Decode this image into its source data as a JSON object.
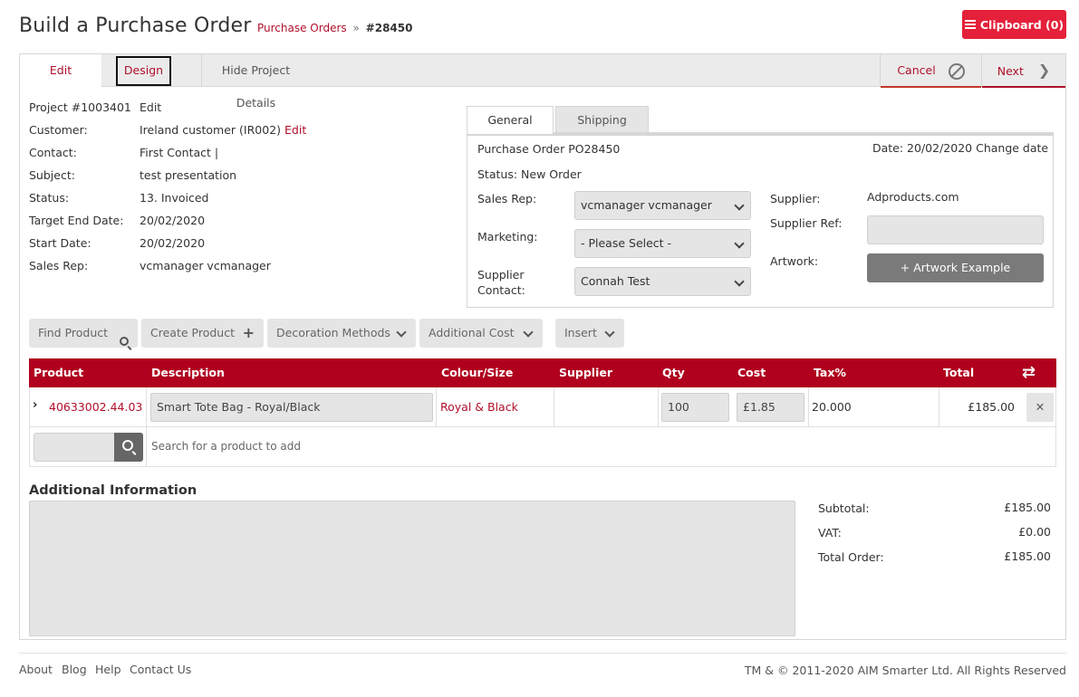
{
  "header": {
    "title": "Build a Purchase Order",
    "breadcrumb_link": "Purchase Orders",
    "breadcrumb_sep": "»",
    "breadcrumb_current": "#28450",
    "clipboard_label": "Clipboard (0)"
  },
  "tabs": {
    "edit": "Edit",
    "design": "Design",
    "hide": "Hide Project Details",
    "cancel": "Cancel",
    "next": "Next"
  },
  "project": {
    "project_label": "Project #1003401",
    "project_edit": "Edit",
    "fields": [
      {
        "label": "Customer:",
        "value": "Ireland customer (IR002)",
        "link": "Edit"
      },
      {
        "label": "Contact:",
        "value": "First Contact |"
      },
      {
        "label": "Subject:",
        "value": "test presentation"
      },
      {
        "label": "Status:",
        "value": "13. Invoiced"
      },
      {
        "label": "Target End Date:",
        "value": "20/02/2020"
      },
      {
        "label": "Start Date:",
        "value": "20/02/2020"
      },
      {
        "label": "Sales Rep:",
        "value": "vcmanager vcmanager"
      }
    ]
  },
  "po": {
    "tab_general": "General",
    "tab_shipping": "Shipping",
    "title": "Purchase Order PO28450",
    "date_label": "Date: 20/02/2020",
    "change_date": "Change date",
    "status_label": "Status:",
    "status_value": "New Order",
    "sales_rep_label": "Sales Rep:",
    "sales_rep_value": "vcmanager vcmanager",
    "marketing_label": "Marketing:",
    "marketing_value": "- Please Select -",
    "supplier_contact_label_1": "Supplier",
    "supplier_contact_label_2": "Contact:",
    "supplier_contact_value": "Connah Test",
    "supplier_label": "Supplier:",
    "supplier_value": "Adproducts.com",
    "supplier_ref_label": "Supplier Ref:",
    "supplier_ref_value": "",
    "artwork_label": "Artwork:",
    "artwork_button": "+ Artwork Example"
  },
  "toolbar": {
    "find_product": "Find Product",
    "create_product": "Create Product",
    "decoration_methods": "Decoration Methods",
    "additional_cost": "Additional Cost",
    "insert": "Insert"
  },
  "table": {
    "headers": [
      "Product",
      "Description",
      "Colour/Size",
      "Supplier",
      "Qty",
      "Cost",
      "Tax%",
      "Total"
    ],
    "rows": [
      {
        "product": "40633002.44.03",
        "description": "Smart Tote Bag - Royal/Black",
        "colour_size": "Royal & Black",
        "supplier": "",
        "qty": "100",
        "cost": "£1.85",
        "tax": "20.000",
        "total": "£185.00"
      }
    ],
    "search_placeholder": "Search for a product to add"
  },
  "additional_info": {
    "title": "Additional Information",
    "text": ""
  },
  "totals": {
    "subtotal_label": "Subtotal:",
    "subtotal_value": "£185.00",
    "vat_label": "VAT:",
    "vat_value": "£0.00",
    "total_label": "Total Order:",
    "total_value": "£185.00"
  },
  "footer": {
    "links": [
      "About",
      "Blog",
      "Help",
      "Contact Us"
    ],
    "copyright": "TM & © 2011-2020 AIM Smarter Ltd. All Rights Reserved"
  },
  "colors": {
    "brand_red": "#b0001e",
    "clipboard_red": "#e4203a",
    "link_red": "#b0102a"
  }
}
